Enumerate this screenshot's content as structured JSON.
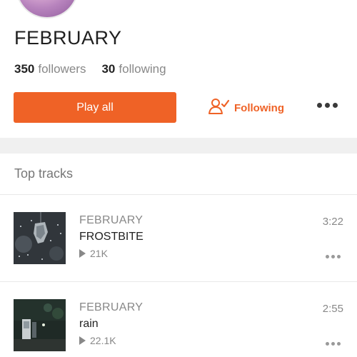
{
  "artist": {
    "name": "FEBRUARY",
    "avatar_icon": "artist-avatar"
  },
  "stats": {
    "followers_count": "350",
    "followers_label": "followers",
    "following_count": "30",
    "following_label": "following"
  },
  "actions": {
    "play_all_label": "Play all",
    "following_label": "Following",
    "follow_icon": "user-check-icon",
    "more_icon": "more-options-icon",
    "accent_color": "#ef6226"
  },
  "top_tracks": {
    "title": "Top tracks",
    "tracks": [
      {
        "artist": "FEBRUARY",
        "title": "FROSTBITE",
        "plays": "21K",
        "duration": "3:22"
      },
      {
        "artist": "FEBRUARY",
        "title": "rain",
        "plays": "22.1K",
        "duration": "2:55"
      }
    ]
  }
}
